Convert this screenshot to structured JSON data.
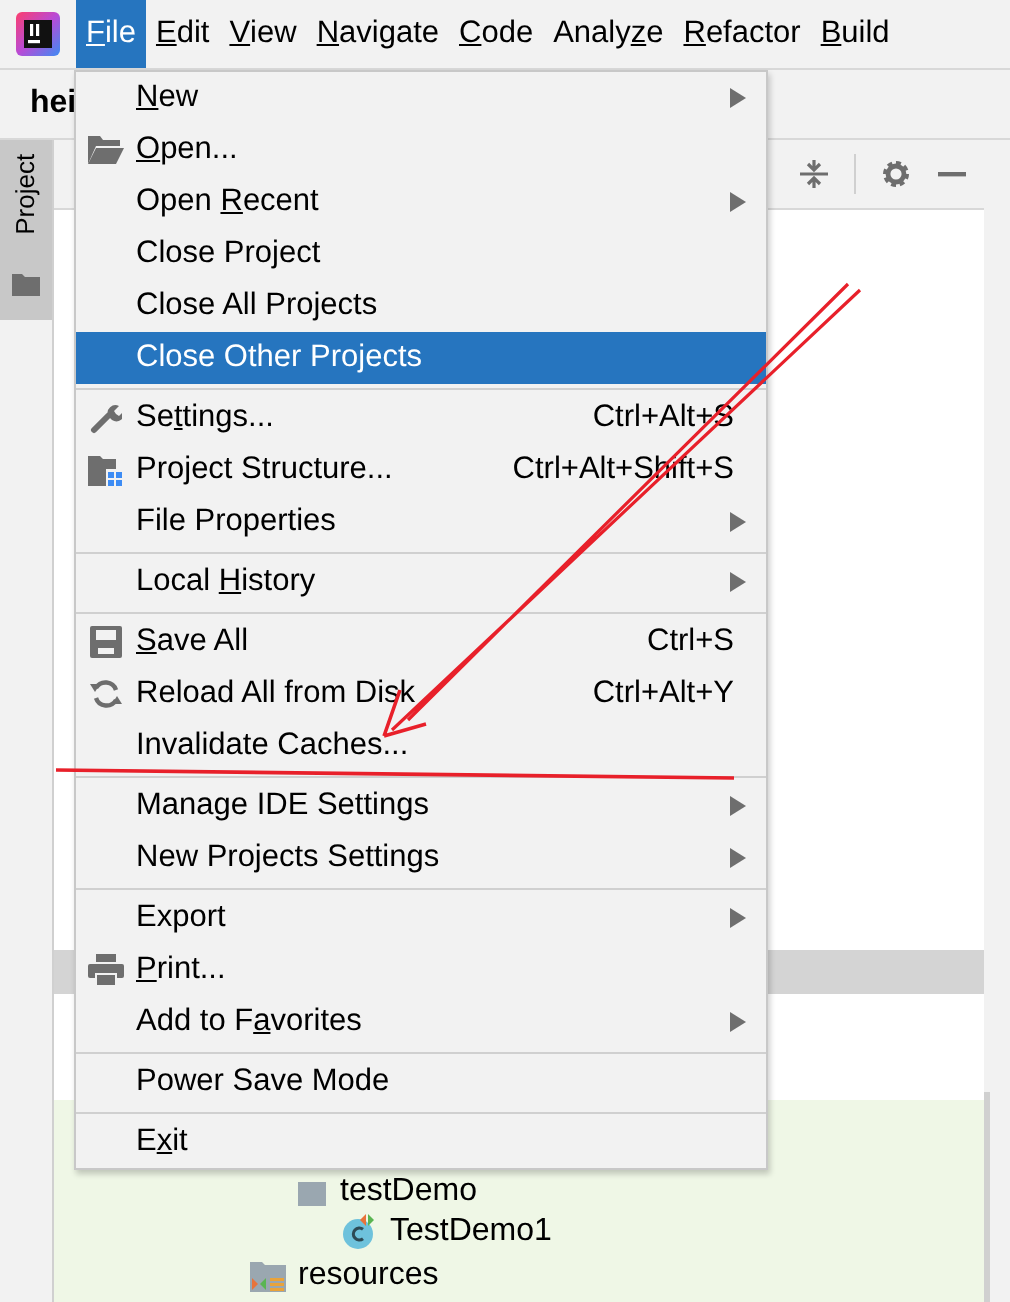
{
  "menu_bar": [
    {
      "label": "File",
      "selected": true
    },
    {
      "label": "Edit",
      "selected": false
    },
    {
      "label": "View",
      "selected": false
    },
    {
      "label": "Navigate",
      "selected": false
    },
    {
      "label": "Code",
      "selected": false
    },
    {
      "label": "Analyze",
      "selected": false
    },
    {
      "label": "Refactor",
      "selected": false
    },
    {
      "label": "Build",
      "selected": false
    }
  ],
  "toolbar": {
    "project_name": "hei"
  },
  "tool_window_tab": {
    "label": "Project",
    "selected": true
  },
  "project_tree": [
    {
      "label": "testDemo",
      "children": [
        {
          "label": "TestDemo1"
        }
      ]
    },
    {
      "label": "resources"
    }
  ],
  "file_menu": [
    {
      "kind": "item",
      "label": "New",
      "submenu": true,
      "selected": false
    },
    {
      "kind": "item",
      "label": "Open...",
      "submenu": false,
      "selected": false
    },
    {
      "kind": "item",
      "label": "Open Recent",
      "submenu": true,
      "selected": false
    },
    {
      "kind": "item",
      "label": "Close Project",
      "submenu": false,
      "selected": false
    },
    {
      "kind": "item",
      "label": "Close All Projects",
      "submenu": false,
      "selected": false
    },
    {
      "kind": "item",
      "label": "Close Other Projects",
      "submenu": false,
      "selected": true
    },
    {
      "kind": "separator"
    },
    {
      "kind": "item",
      "label": "Settings...",
      "shortcut": "Ctrl+Alt+S",
      "submenu": false,
      "selected": false
    },
    {
      "kind": "item",
      "label": "Project Structure...",
      "shortcut": "Ctrl+Alt+Shift+S",
      "submenu": false,
      "selected": false
    },
    {
      "kind": "item",
      "label": "File Properties",
      "submenu": true,
      "selected": false
    },
    {
      "kind": "separator"
    },
    {
      "kind": "item",
      "label": "Local History",
      "submenu": true,
      "selected": false
    },
    {
      "kind": "separator"
    },
    {
      "kind": "item",
      "label": "Save All",
      "shortcut": "Ctrl+S",
      "submenu": false,
      "selected": false
    },
    {
      "kind": "item",
      "label": "Reload All from Disk",
      "shortcut": "Ctrl+Alt+Y",
      "submenu": false,
      "selected": false
    },
    {
      "kind": "item",
      "label": "Invalidate Caches...",
      "submenu": false,
      "selected": false
    },
    {
      "kind": "separator"
    },
    {
      "kind": "item",
      "label": "Manage IDE Settings",
      "submenu": true,
      "selected": false
    },
    {
      "kind": "item",
      "label": "New Projects Settings",
      "submenu": true,
      "selected": false
    },
    {
      "kind": "separator"
    },
    {
      "kind": "item",
      "label": "Export",
      "submenu": true,
      "selected": false
    },
    {
      "kind": "item",
      "label": "Print...",
      "submenu": false,
      "selected": false
    },
    {
      "kind": "item",
      "label": "Add to Favorites",
      "submenu": true,
      "selected": false
    },
    {
      "kind": "separator"
    },
    {
      "kind": "item",
      "label": "Power Save Mode",
      "submenu": false,
      "selected": false
    },
    {
      "kind": "separator"
    },
    {
      "kind": "item",
      "label": "Exit",
      "submenu": false,
      "selected": false
    }
  ]
}
